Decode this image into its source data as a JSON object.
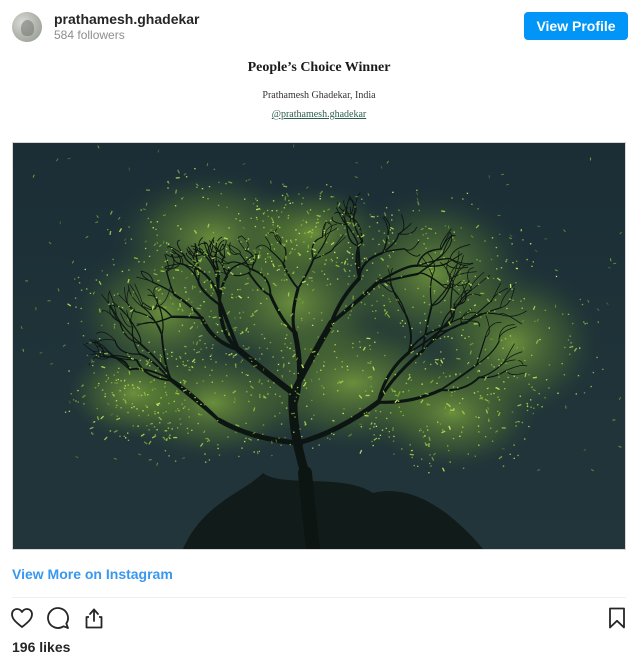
{
  "header": {
    "username": "prathamesh.ghadekar",
    "followers": "584 followers",
    "view_profile_label": "View Profile",
    "avatar_icon": "profile-avatar-icon"
  },
  "post": {
    "award_title": "People’s Choice Winner",
    "award_name": "Prathamesh Ghadekar, India",
    "award_handle": "@prathamesh.ghadekar",
    "photo_subject": "firefly-tree-photo"
  },
  "footer": {
    "view_more_label": "View More on Instagram",
    "likes": "196 likes",
    "icons": [
      "heart-icon",
      "comment-icon",
      "share-icon",
      "bookmark-icon"
    ]
  },
  "colors": {
    "accent": "#0095f6",
    "link": "#3897f0",
    "photo_bg": "#1f3339",
    "firefly_glow": "#9fd43a"
  }
}
